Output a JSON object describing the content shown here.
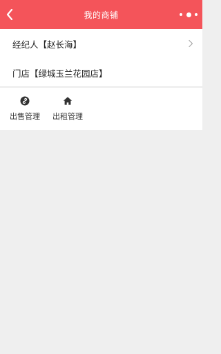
{
  "navbar": {
    "title": "我的商铺",
    "back_icon": "chevron-left-icon",
    "more_icon": "more-dots-icon",
    "background": "#f4545a"
  },
  "info": {
    "agent_label": "经纪人【赵长海】",
    "store_label": "门店【绿城玉兰花园店】",
    "chevron_icon": "chevron-right-icon"
  },
  "menu": [
    {
      "label": "出售管理",
      "icon": "link-icon"
    },
    {
      "label": "出租管理",
      "icon": "home-icon"
    }
  ]
}
